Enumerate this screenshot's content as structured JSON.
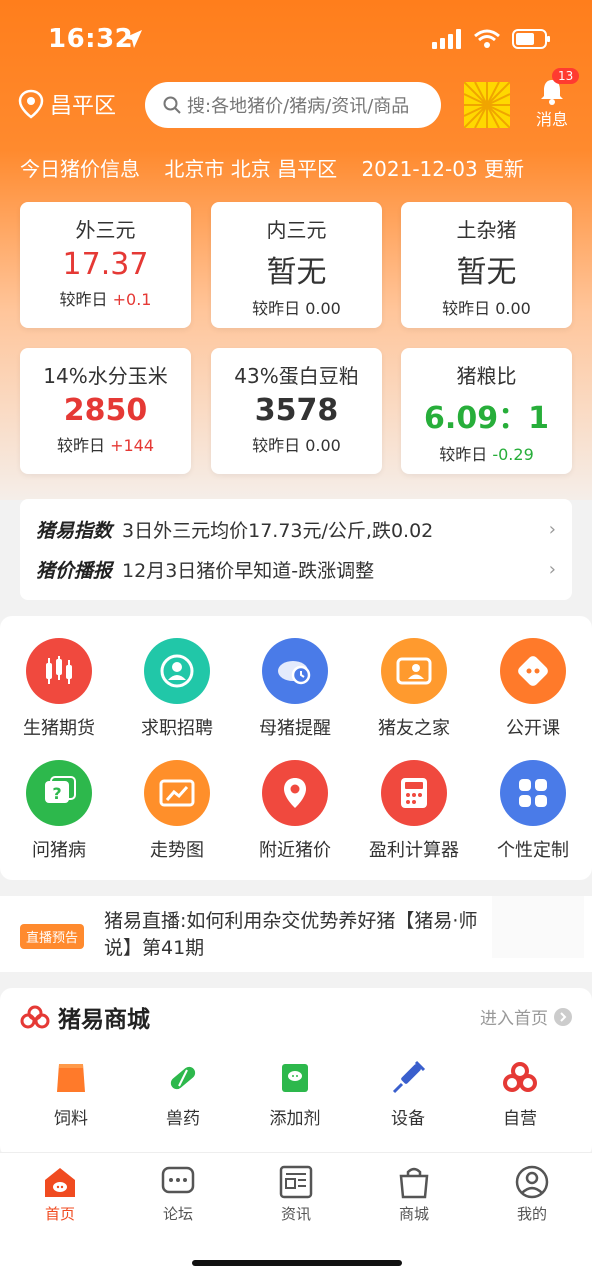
{
  "status_bar": {
    "time": "16:32"
  },
  "topbar": {
    "location": "昌平区",
    "search_placeholder": "搜:各地猪价/猪病/资讯/商品",
    "notification_count": "13",
    "notification_label": "消息"
  },
  "price_header": {
    "title": "今日猪价信息",
    "location": "北京市 北京 昌平区",
    "updated": "2021-12-03 更新"
  },
  "price_cards": [
    {
      "title": "外三元",
      "value": "17.37",
      "compare_label": "较昨日",
      "compare_value": "+0.1"
    },
    {
      "title": "内三元",
      "value": "暂无",
      "compare_label": "较昨日",
      "compare_value": "0.00"
    },
    {
      "title": "土杂猪",
      "value": "暂无",
      "compare_label": "较昨日",
      "compare_value": "0.00"
    },
    {
      "title": "14%水分玉米",
      "value": "2850",
      "compare_label": "较昨日",
      "compare_value": "+144"
    },
    {
      "title": "43%蛋白豆粕",
      "value": "3578",
      "compare_label": "较昨日",
      "compare_value": "0.00"
    },
    {
      "title": "猪粮比",
      "value": "6.09：1",
      "compare_label": "较昨日",
      "compare_value": "-0.29"
    }
  ],
  "news": [
    {
      "tag": "猪易指数",
      "text": "3日外三元均价17.73元/公斤,跌0.02"
    },
    {
      "tag": "猪价播报",
      "text": "12月3日猪价早知道-跌涨调整"
    }
  ],
  "features": [
    {
      "label": "生猪期货",
      "color": "#f0493e",
      "icon": "candlestick-icon"
    },
    {
      "label": "求职招聘",
      "color": "#21c7a8",
      "icon": "person-icon"
    },
    {
      "label": "母猪提醒",
      "color": "#4a7be8",
      "icon": "pig-clock-icon"
    },
    {
      "label": "猪友之家",
      "color": "#ff9a2e",
      "icon": "profile-card-icon"
    },
    {
      "label": "公开课",
      "color": "#ff7a2a",
      "icon": "play-icon"
    },
    {
      "label": "问猪病",
      "color": "#2db84c",
      "icon": "question-icon"
    },
    {
      "label": "走势图",
      "color": "#ff8f2a",
      "icon": "trend-icon"
    },
    {
      "label": "附近猪价",
      "color": "#f0493e",
      "icon": "location-pin-icon"
    },
    {
      "label": "盈利计算器",
      "color": "#f0493e",
      "icon": "calculator-icon"
    },
    {
      "label": "个性定制",
      "color": "#4a7be8",
      "icon": "grid-icon"
    }
  ],
  "live": {
    "tag": "直播预告",
    "text": "猪易直播:如何利用杂交优势养好猪【猪易·师说】第41期"
  },
  "mall": {
    "title": "猪易商城",
    "more": "进入首页",
    "items": [
      {
        "label": "饲料",
        "icon": "feed-bag-icon"
      },
      {
        "label": "兽药",
        "icon": "pill-icon"
      },
      {
        "label": "添加剂",
        "icon": "additive-icon"
      },
      {
        "label": "设备",
        "icon": "syringe-icon"
      },
      {
        "label": "自营",
        "icon": "brand-icon"
      }
    ]
  },
  "tabs": [
    {
      "label": "首页",
      "icon": "home-icon"
    },
    {
      "label": "论坛",
      "icon": "chat-icon"
    },
    {
      "label": "资讯",
      "icon": "news-icon"
    },
    {
      "label": "商城",
      "icon": "bag-icon"
    },
    {
      "label": "我的",
      "icon": "user-icon"
    }
  ],
  "colors": {
    "accent": "#ff7e1c",
    "up": "#e53935",
    "down": "#27ae3a",
    "tab_active": "#f04b20"
  }
}
